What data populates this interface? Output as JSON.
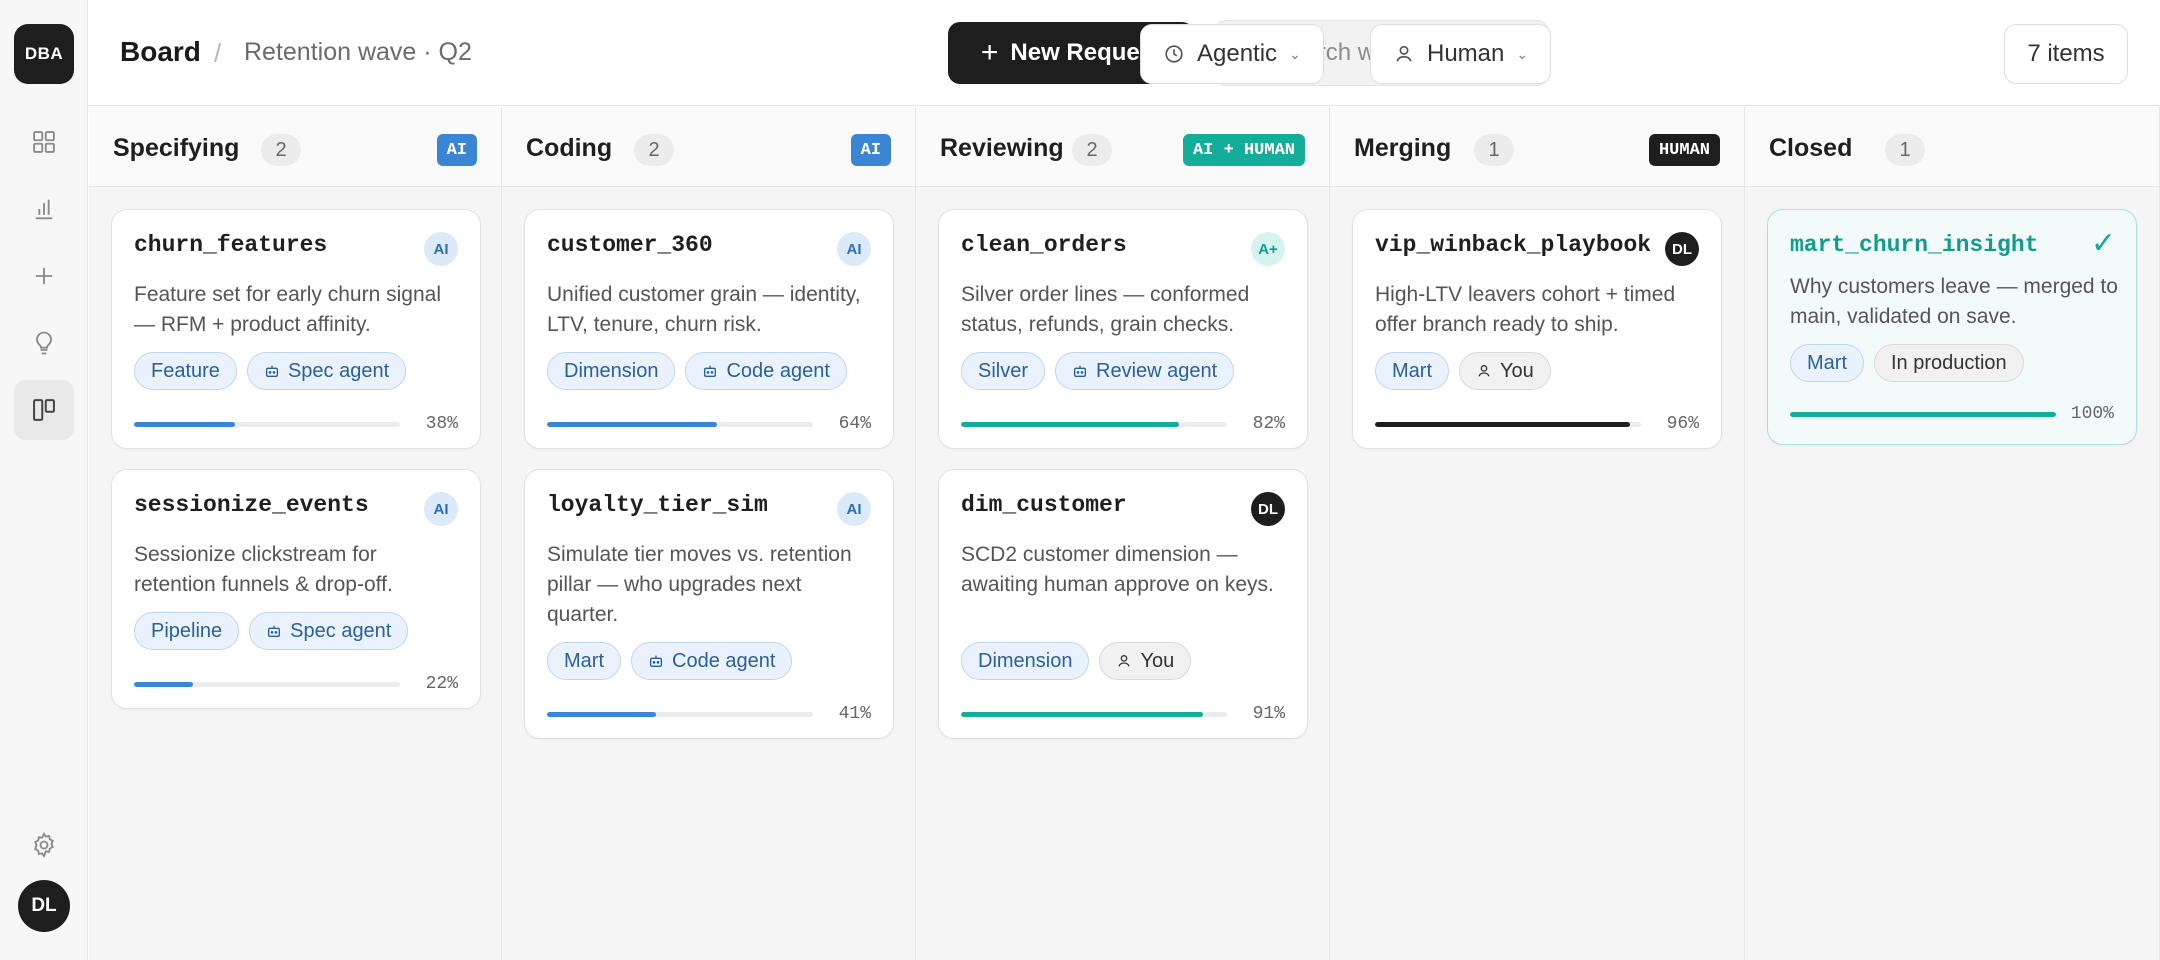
{
  "sidebar": {
    "logo": "DBA",
    "user_initials": "DL",
    "icons": [
      "grid-icon",
      "chart-icon",
      "plus-icon",
      "lightbulb-icon",
      "board-icon",
      "gear-icon"
    ]
  },
  "header": {
    "title": "Board",
    "subtitle": "Retention wave · Q2",
    "new_request": "New Request",
    "search_placeholder": "Search work items...",
    "filter_mode": "Agentic",
    "filter_owner": "Human",
    "item_count": "7 items"
  },
  "colors": {
    "ai": "#3b86d4",
    "ai_human": "#14ad9a",
    "human": "#1e1e1e",
    "done": "#14ad9a"
  },
  "columns": [
    {
      "title": "Specifying",
      "count": "2",
      "tag": "AI",
      "cards": [
        {
          "title": "churn_features",
          "badge": "AI",
          "desc": "Feature set for early churn signal — RFM + product affinity.",
          "chips": [
            "Feature",
            "Spec agent"
          ],
          "progress": "38%",
          "progress_value": 38
        },
        {
          "title": "sessionize_events",
          "badge": "AI",
          "desc": "Sessionize clickstream for retention funnels & drop-off.",
          "chips": [
            "Pipeline",
            "Spec agent"
          ],
          "progress": "22%",
          "progress_value": 22
        }
      ]
    },
    {
      "title": "Coding",
      "count": "2",
      "tag": "AI",
      "cards": [
        {
          "title": "customer_360",
          "badge": "AI",
          "desc": "Unified customer grain — identity, LTV, tenure, churn risk.",
          "chips": [
            "Dimension",
            "Code agent"
          ],
          "progress": "64%",
          "progress_value": 64
        },
        {
          "title": "loyalty_tier_sim",
          "badge": "AI",
          "desc": "Simulate tier moves vs. retention pillar — who upgrades next quarter.",
          "chips": [
            "Mart",
            "Code agent"
          ],
          "progress": "41%",
          "progress_value": 41
        }
      ]
    },
    {
      "title": "Reviewing",
      "count": "2",
      "tag": "AI + HUMAN",
      "cards": [
        {
          "title": "clean_orders",
          "badge": "A+",
          "desc": "Silver order lines — conformed status, refunds, grain checks.",
          "chips": [
            "Silver",
            "Review agent"
          ],
          "progress": "82%",
          "progress_value": 82
        },
        {
          "title": "dim_customer",
          "badge": "DL",
          "desc": "SCD2 customer dimension — awaiting human approve on keys.",
          "chips": [
            "Dimension",
            "You"
          ],
          "progress": "91%",
          "progress_value": 91
        }
      ]
    },
    {
      "title": "Merging",
      "count": "1",
      "tag": "HUMAN",
      "cards": [
        {
          "title": "vip_winback_playbook",
          "badge": "DL",
          "desc": "High-LTV leavers cohort + timed offer branch ready to ship.",
          "chips": [
            "Mart",
            "You"
          ],
          "progress": "96%",
          "progress_value": 96
        }
      ]
    },
    {
      "title": "Closed",
      "count": "1",
      "tag": "",
      "cards": [
        {
          "title": "mart_churn_insight",
          "badge": "✓",
          "desc": "Why customers leave — merged to main, validated on save.",
          "chips": [
            "Mart",
            "In production"
          ],
          "progress": "100%",
          "progress_value": 100
        }
      ]
    }
  ]
}
